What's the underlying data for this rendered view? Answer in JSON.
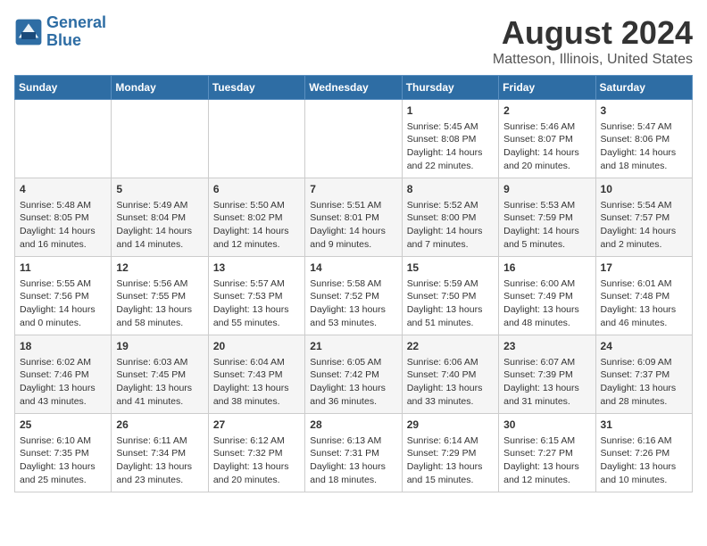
{
  "header": {
    "logo_line1": "General",
    "logo_line2": "Blue",
    "title": "August 2024",
    "subtitle": "Matteson, Illinois, United States"
  },
  "days_of_week": [
    "Sunday",
    "Monday",
    "Tuesday",
    "Wednesday",
    "Thursday",
    "Friday",
    "Saturday"
  ],
  "weeks": [
    [
      {
        "day": "",
        "info": ""
      },
      {
        "day": "",
        "info": ""
      },
      {
        "day": "",
        "info": ""
      },
      {
        "day": "",
        "info": ""
      },
      {
        "day": "1",
        "info": "Sunrise: 5:45 AM\nSunset: 8:08 PM\nDaylight: 14 hours\nand 22 minutes."
      },
      {
        "day": "2",
        "info": "Sunrise: 5:46 AM\nSunset: 8:07 PM\nDaylight: 14 hours\nand 20 minutes."
      },
      {
        "day": "3",
        "info": "Sunrise: 5:47 AM\nSunset: 8:06 PM\nDaylight: 14 hours\nand 18 minutes."
      }
    ],
    [
      {
        "day": "4",
        "info": "Sunrise: 5:48 AM\nSunset: 8:05 PM\nDaylight: 14 hours\nand 16 minutes."
      },
      {
        "day": "5",
        "info": "Sunrise: 5:49 AM\nSunset: 8:04 PM\nDaylight: 14 hours\nand 14 minutes."
      },
      {
        "day": "6",
        "info": "Sunrise: 5:50 AM\nSunset: 8:02 PM\nDaylight: 14 hours\nand 12 minutes."
      },
      {
        "day": "7",
        "info": "Sunrise: 5:51 AM\nSunset: 8:01 PM\nDaylight: 14 hours\nand 9 minutes."
      },
      {
        "day": "8",
        "info": "Sunrise: 5:52 AM\nSunset: 8:00 PM\nDaylight: 14 hours\nand 7 minutes."
      },
      {
        "day": "9",
        "info": "Sunrise: 5:53 AM\nSunset: 7:59 PM\nDaylight: 14 hours\nand 5 minutes."
      },
      {
        "day": "10",
        "info": "Sunrise: 5:54 AM\nSunset: 7:57 PM\nDaylight: 14 hours\nand 2 minutes."
      }
    ],
    [
      {
        "day": "11",
        "info": "Sunrise: 5:55 AM\nSunset: 7:56 PM\nDaylight: 14 hours\nand 0 minutes."
      },
      {
        "day": "12",
        "info": "Sunrise: 5:56 AM\nSunset: 7:55 PM\nDaylight: 13 hours\nand 58 minutes."
      },
      {
        "day": "13",
        "info": "Sunrise: 5:57 AM\nSunset: 7:53 PM\nDaylight: 13 hours\nand 55 minutes."
      },
      {
        "day": "14",
        "info": "Sunrise: 5:58 AM\nSunset: 7:52 PM\nDaylight: 13 hours\nand 53 minutes."
      },
      {
        "day": "15",
        "info": "Sunrise: 5:59 AM\nSunset: 7:50 PM\nDaylight: 13 hours\nand 51 minutes."
      },
      {
        "day": "16",
        "info": "Sunrise: 6:00 AM\nSunset: 7:49 PM\nDaylight: 13 hours\nand 48 minutes."
      },
      {
        "day": "17",
        "info": "Sunrise: 6:01 AM\nSunset: 7:48 PM\nDaylight: 13 hours\nand 46 minutes."
      }
    ],
    [
      {
        "day": "18",
        "info": "Sunrise: 6:02 AM\nSunset: 7:46 PM\nDaylight: 13 hours\nand 43 minutes."
      },
      {
        "day": "19",
        "info": "Sunrise: 6:03 AM\nSunset: 7:45 PM\nDaylight: 13 hours\nand 41 minutes."
      },
      {
        "day": "20",
        "info": "Sunrise: 6:04 AM\nSunset: 7:43 PM\nDaylight: 13 hours\nand 38 minutes."
      },
      {
        "day": "21",
        "info": "Sunrise: 6:05 AM\nSunset: 7:42 PM\nDaylight: 13 hours\nand 36 minutes."
      },
      {
        "day": "22",
        "info": "Sunrise: 6:06 AM\nSunset: 7:40 PM\nDaylight: 13 hours\nand 33 minutes."
      },
      {
        "day": "23",
        "info": "Sunrise: 6:07 AM\nSunset: 7:39 PM\nDaylight: 13 hours\nand 31 minutes."
      },
      {
        "day": "24",
        "info": "Sunrise: 6:09 AM\nSunset: 7:37 PM\nDaylight: 13 hours\nand 28 minutes."
      }
    ],
    [
      {
        "day": "25",
        "info": "Sunrise: 6:10 AM\nSunset: 7:35 PM\nDaylight: 13 hours\nand 25 minutes."
      },
      {
        "day": "26",
        "info": "Sunrise: 6:11 AM\nSunset: 7:34 PM\nDaylight: 13 hours\nand 23 minutes."
      },
      {
        "day": "27",
        "info": "Sunrise: 6:12 AM\nSunset: 7:32 PM\nDaylight: 13 hours\nand 20 minutes."
      },
      {
        "day": "28",
        "info": "Sunrise: 6:13 AM\nSunset: 7:31 PM\nDaylight: 13 hours\nand 18 minutes."
      },
      {
        "day": "29",
        "info": "Sunrise: 6:14 AM\nSunset: 7:29 PM\nDaylight: 13 hours\nand 15 minutes."
      },
      {
        "day": "30",
        "info": "Sunrise: 6:15 AM\nSunset: 7:27 PM\nDaylight: 13 hours\nand 12 minutes."
      },
      {
        "day": "31",
        "info": "Sunrise: 6:16 AM\nSunset: 7:26 PM\nDaylight: 13 hours\nand 10 minutes."
      }
    ]
  ]
}
